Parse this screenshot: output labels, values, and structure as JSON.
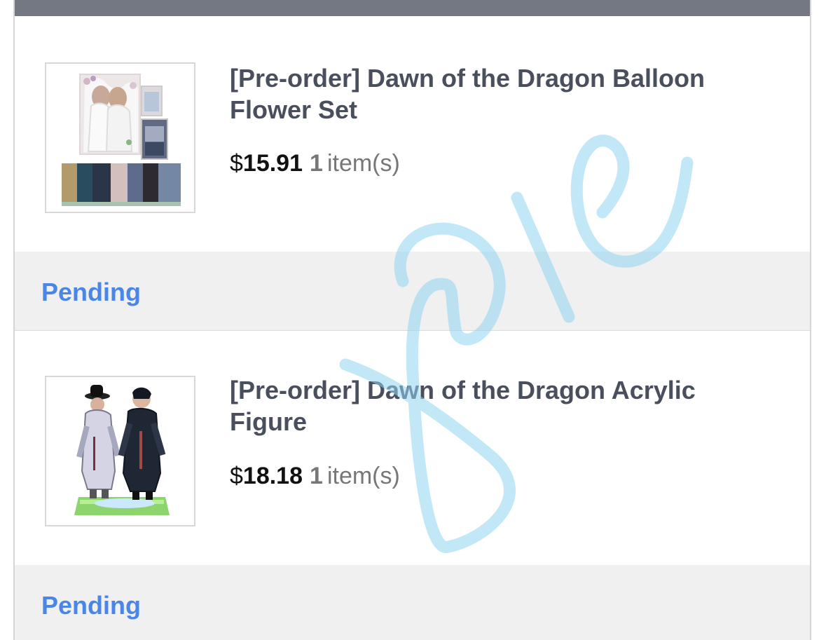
{
  "orders": [
    {
      "title": "[Pre-order] Dawn of the Dragon Balloon Flower Set",
      "currency": "$",
      "amount": "15.91",
      "quantity": "1",
      "quantity_unit": "item(s)",
      "status": "Pending",
      "thumbnail": "balloon-flower-set-product-image"
    },
    {
      "title": "[Pre-order] Dawn of the Dragon Acrylic Figure",
      "currency": "$",
      "amount": "18.18",
      "quantity": "1",
      "quantity_unit": "item(s)",
      "status": "Pending",
      "thumbnail": "acrylic-figure-product-image"
    }
  ],
  "colors": {
    "top_bar": "#737883",
    "title": "#4a4f5d",
    "status": "#4a86e8",
    "status_background": "#f0f0f0",
    "watermark": "#8fd3ef"
  },
  "watermark": "handwritten-scribble-watermark"
}
